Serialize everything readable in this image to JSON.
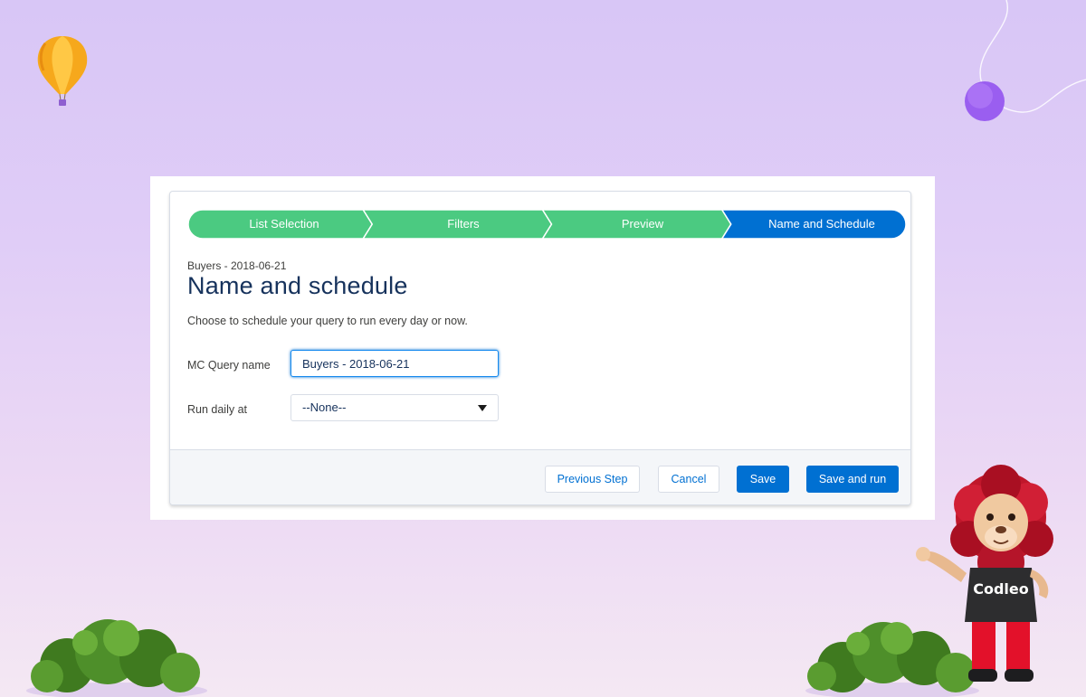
{
  "path": {
    "steps": [
      {
        "label": "List Selection",
        "state": "complete"
      },
      {
        "label": "Filters",
        "state": "complete"
      },
      {
        "label": "Preview",
        "state": "complete"
      },
      {
        "label": "Name and Schedule",
        "state": "current"
      }
    ],
    "colors": {
      "complete": "#4bca81",
      "current": "#0070d2",
      "separator": "#ffffff"
    }
  },
  "header": {
    "eyebrow": "Buyers - 2018-06-21",
    "title": "Name and schedule",
    "description": "Choose to schedule your query to run every day or now."
  },
  "form": {
    "query_name_label": "MC Query name",
    "query_name_value": "Buyers - 2018-06-21",
    "run_daily_label": "Run daily at",
    "run_daily_value": "--None--"
  },
  "footer": {
    "previous_label": "Previous Step",
    "cancel_label": "Cancel",
    "save_label": "Save",
    "save_run_label": "Save and run"
  },
  "mascot": {
    "shirt_text": "Codleo"
  }
}
